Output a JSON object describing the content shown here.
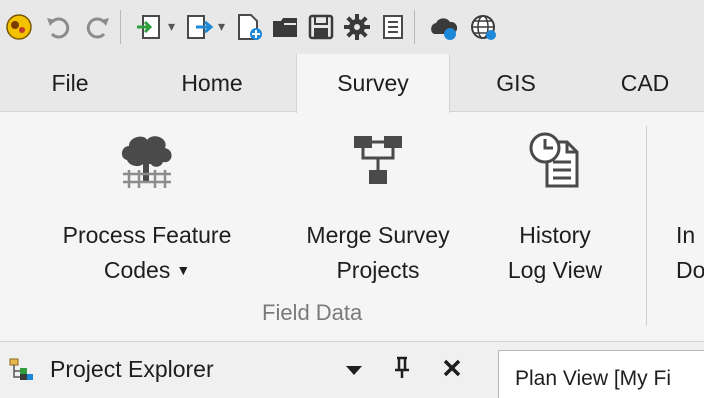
{
  "toolbar": {
    "icons": [
      "app-logo-icon",
      "undo-icon",
      "redo-icon",
      "import-icon",
      "export-icon",
      "new-project-icon",
      "open-folder-icon",
      "save-icon",
      "settings-icon",
      "properties-icon",
      "cloud-services-icon",
      "globe-icon"
    ],
    "dropdown_glyph": "▾"
  },
  "tabs": [
    {
      "label": "File",
      "active": false
    },
    {
      "label": "Home",
      "active": false
    },
    {
      "label": "Survey",
      "active": true
    },
    {
      "label": "GIS",
      "active": false
    },
    {
      "label": "CAD",
      "active": false
    }
  ],
  "ribbon": {
    "group_label": "Field Data",
    "buttons": [
      {
        "line1": "Process Feature",
        "line2": "Codes",
        "icon": "feature-codes-tree-icon",
        "has_dropdown": true
      },
      {
        "line1": "Merge Survey",
        "line2": "Projects",
        "icon": "merge-projects-icon",
        "has_dropdown": false
      },
      {
        "line1": "History",
        "line2": "Log View",
        "icon": "history-log-icon",
        "has_dropdown": false
      },
      {
        "line1": "In",
        "line2": "Do",
        "icon": "",
        "has_dropdown": false
      }
    ],
    "dropdown_glyph": "▼"
  },
  "panes": {
    "project_explorer": {
      "title": "Project Explorer",
      "icon": "project-explorer-icon",
      "dropdown_glyph": "▼",
      "pin_glyph": "ᵖ",
      "close_glyph": "✕"
    },
    "document_tab": {
      "label": "Plan View [My Fi"
    }
  },
  "colors": {
    "ribbon_bg": "#f5f5f5",
    "toolbar_bg": "#e8e8e8",
    "accent_blue": "#1e88d8",
    "icon_dark": "#4a4a4a",
    "group_label": "#7a7a7a"
  }
}
